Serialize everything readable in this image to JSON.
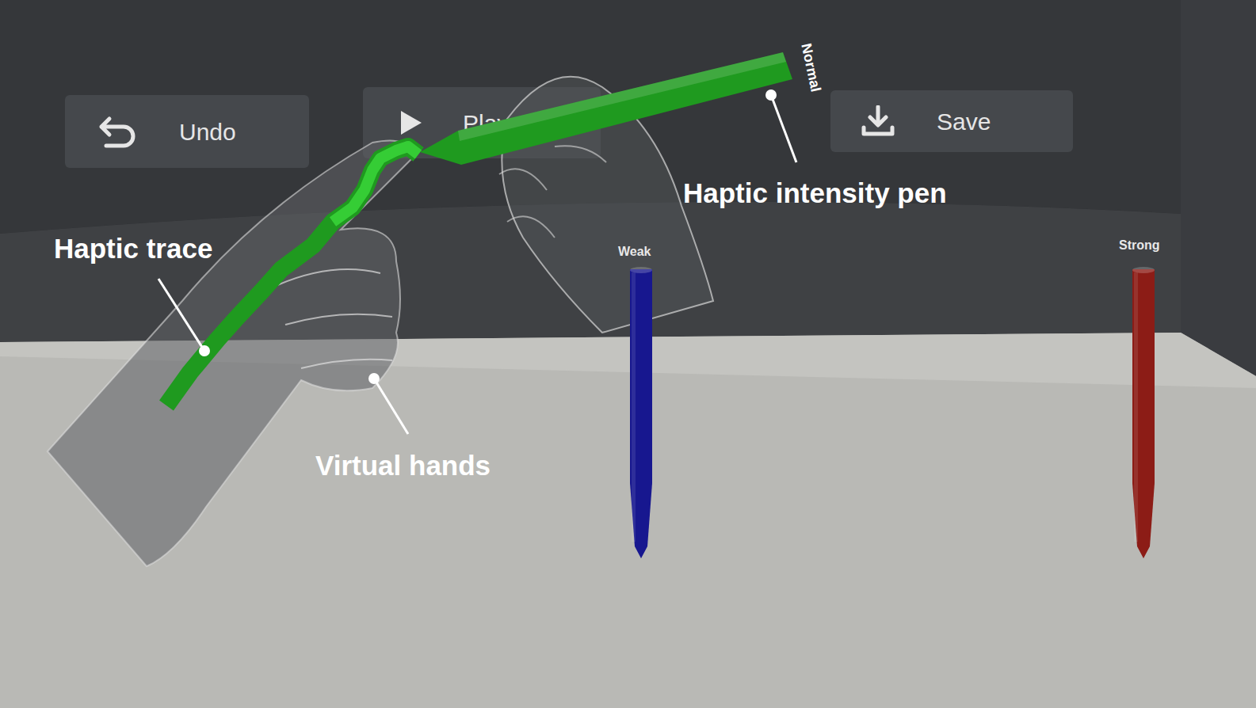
{
  "toolbar": {
    "buttons": [
      {
        "label": "Undo"
      },
      {
        "label": "Play"
      },
      {
        "label": "Save"
      }
    ]
  },
  "pens": [
    {
      "label": "Normal",
      "color": "#1f9a1f",
      "held": true
    },
    {
      "label": "Weak",
      "color": "#17178f",
      "held": false
    },
    {
      "label": "Strong",
      "color": "#8c1c16",
      "held": false
    }
  ],
  "annotations": [
    {
      "text": "Haptic trace"
    },
    {
      "text": "Haptic intensity pen"
    },
    {
      "text": "Virtual hands"
    }
  ]
}
